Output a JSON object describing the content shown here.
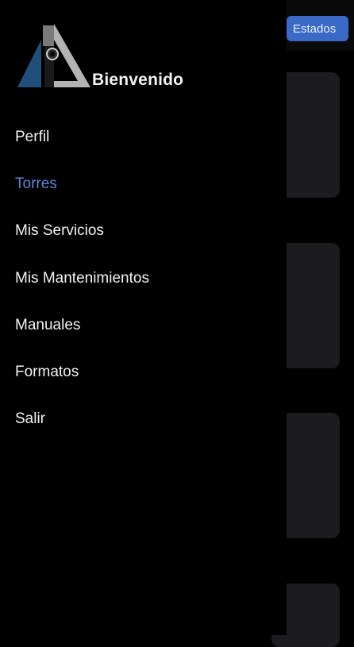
{
  "background_page": {
    "status_button_label": "Estados"
  },
  "drawer": {
    "welcome_text": "Bienvenido",
    "menu_items": [
      {
        "label": "Perfil",
        "active": false
      },
      {
        "label": "Torres",
        "active": true
      },
      {
        "label": "Mis Servicios",
        "active": false
      },
      {
        "label": "Mis Mantenimientos",
        "active": false
      },
      {
        "label": "Manuales",
        "active": false
      },
      {
        "label": "Formatos",
        "active": false
      },
      {
        "label": "Salir",
        "active": false
      }
    ]
  },
  "colors": {
    "background": "#000000",
    "active_menu_text": "#5e82d9",
    "menu_text": "#f2f2f2",
    "status_button": "#3a69c6",
    "card": "#1c1c1e",
    "logo_blue": "#1f4f7a",
    "logo_gray": "#b3b3b3"
  },
  "icons": {
    "logo": "tower-triangle-logo-icon"
  }
}
